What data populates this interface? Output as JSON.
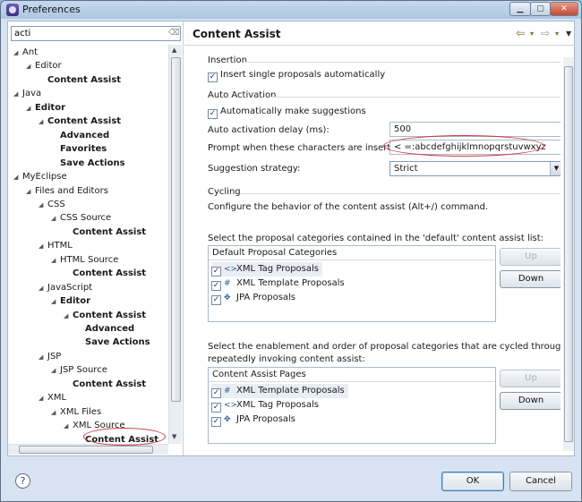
{
  "window": {
    "title": "Preferences"
  },
  "filter": {
    "value": "acti"
  },
  "tree": [
    {
      "label": "Ant",
      "bold": false,
      "twisty": "◢"
    },
    {
      "label": "Editor",
      "bold": false,
      "twisty": "◢"
    },
    {
      "label": "Content Assist",
      "bold": true,
      "twisty": ""
    },
    {
      "label": "Java",
      "bold": false,
      "twisty": "◢"
    },
    {
      "label": "Editor",
      "bold": true,
      "twisty": "◢"
    },
    {
      "label": "Content Assist",
      "bold": true,
      "twisty": "◢"
    },
    {
      "label": "Advanced",
      "bold": true,
      "twisty": ""
    },
    {
      "label": "Favorites",
      "bold": true,
      "twisty": ""
    },
    {
      "label": "Save Actions",
      "bold": true,
      "twisty": ""
    },
    {
      "label": "MyEclipse",
      "bold": false,
      "twisty": "◢"
    },
    {
      "label": "Files and Editors",
      "bold": false,
      "twisty": "◢"
    },
    {
      "label": "CSS",
      "bold": false,
      "twisty": "◢"
    },
    {
      "label": "CSS Source",
      "bold": false,
      "twisty": "◢"
    },
    {
      "label": "Content Assist",
      "bold": true,
      "twisty": ""
    },
    {
      "label": "HTML",
      "bold": false,
      "twisty": "◢"
    },
    {
      "label": "HTML Source",
      "bold": false,
      "twisty": "◢"
    },
    {
      "label": "Content Assist",
      "bold": true,
      "twisty": ""
    },
    {
      "label": "JavaScript",
      "bold": false,
      "twisty": "◢"
    },
    {
      "label": "Editor",
      "bold": true,
      "twisty": "◢"
    },
    {
      "label": "Content Assist",
      "bold": true,
      "twisty": "◢"
    },
    {
      "label": "Advanced",
      "bold": true,
      "twisty": ""
    },
    {
      "label": "Save Actions",
      "bold": true,
      "twisty": ""
    },
    {
      "label": "JSP",
      "bold": false,
      "twisty": "◢"
    },
    {
      "label": "JSP Source",
      "bold": false,
      "twisty": "◢"
    },
    {
      "label": "Content Assist",
      "bold": true,
      "twisty": ""
    },
    {
      "label": "XML",
      "bold": false,
      "twisty": "◢"
    },
    {
      "label": "XML Files",
      "bold": false,
      "twisty": "◢"
    },
    {
      "label": "XML Source",
      "bold": false,
      "twisty": "◢"
    },
    {
      "label": "Content Assist",
      "bold": true,
      "twisty": ""
    }
  ],
  "page": {
    "title": "Content Assist",
    "insertion": {
      "group": "Insertion",
      "insert_single": "Insert single proposals automatically"
    },
    "auto_activation": {
      "group": "Auto Activation",
      "make_suggestions": "Automatically make suggestions",
      "delay_label": "Auto activation delay (ms):",
      "delay_value": "500",
      "prompt_label": "Prompt when these characters are inserted:",
      "prompt_value": "< =:abcdefghijklmnopqrstuvwxyz",
      "strategy_label": "Suggestion strategy:",
      "strategy_value": "Strict"
    },
    "cycling": {
      "group": "Cycling",
      "description": "Configure the behavior of the content assist (Alt+/) command.",
      "default_list_label": "Select the proposal categories contained in the 'default' content assist list:",
      "default_header": "Default Proposal Categories",
      "default_items": [
        {
          "icon": "<>",
          "label": "XML Tag Proposals"
        },
        {
          "icon": "#",
          "label": "XML Template Proposals"
        },
        {
          "icon": "✥",
          "label": "JPA Proposals"
        }
      ],
      "cycle_label_1": "Select the enablement and order of proposal categories that are cycled through when",
      "cycle_label_2": "repeatedly invoking content assist:",
      "pages_header": "Content Assist Pages",
      "pages_items": [
        {
          "icon": "#",
          "label": "XML Template Proposals"
        },
        {
          "icon": "<>",
          "label": "XML Tag Proposals"
        },
        {
          "icon": "✥",
          "label": "JPA Proposals"
        }
      ],
      "up": "Up",
      "down": "Down"
    }
  },
  "footer": {
    "ok": "OK",
    "cancel": "Cancel"
  },
  "colors": {
    "accent": "#3c7fb1",
    "highlight_ring": "#d2343a"
  }
}
